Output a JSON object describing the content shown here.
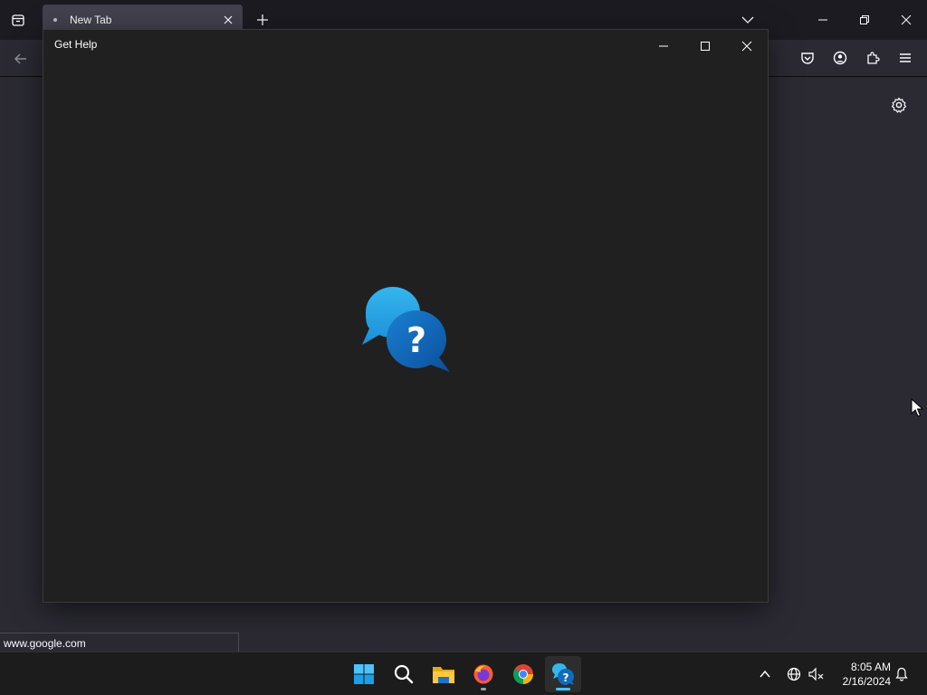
{
  "firefox": {
    "tab_title": "New Tab",
    "status_url": "www.google.com"
  },
  "get_help": {
    "title": "Get Help"
  },
  "taskbar": {
    "apps": [
      "start-icon",
      "search-icon",
      "file-explorer-icon",
      "firefox-icon",
      "chrome-icon",
      "get-help-icon"
    ],
    "time": "8:05 AM",
    "date": "2/16/2024"
  },
  "colors": {
    "accent": "#0078d4",
    "help_bubble_light": "#4cc2f1",
    "help_bubble_dark": "#0f6cbd"
  }
}
